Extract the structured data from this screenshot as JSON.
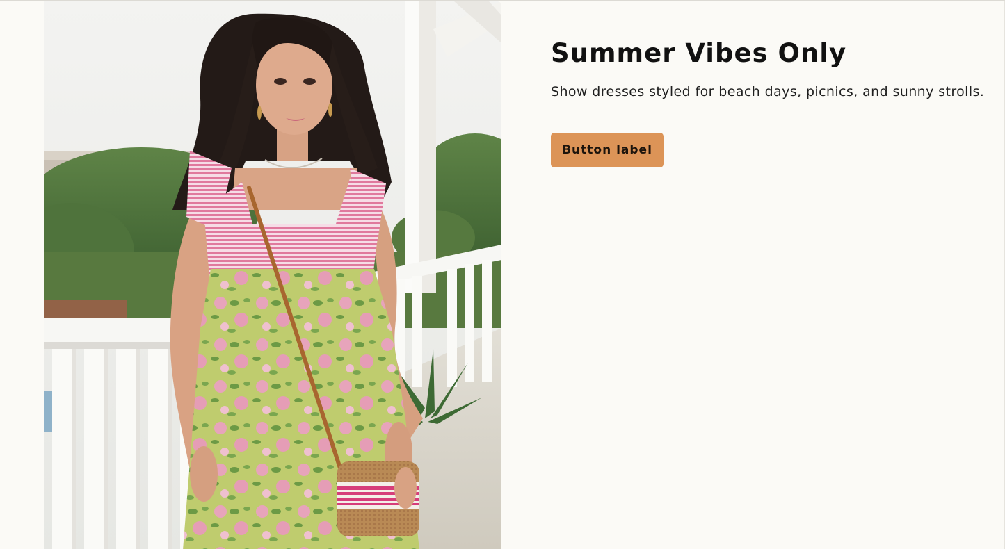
{
  "hero": {
    "title": "Summer Vibes Only",
    "subtitle": "Show dresses styled for beach days, picnics, and sunny strolls.",
    "button_label": "Button label"
  },
  "image": {
    "alt": "Model in a pink striped and green floral sundress with a woven crossbody bag on a white porch"
  },
  "colors": {
    "page_background": "#fbfaf6",
    "button_background": "#dc9457",
    "title_text": "#111111",
    "dress_top_pink": "#e58fae",
    "dress_skirt_green": "#b6c56a",
    "bag_strap_brown": "#a8662f"
  }
}
